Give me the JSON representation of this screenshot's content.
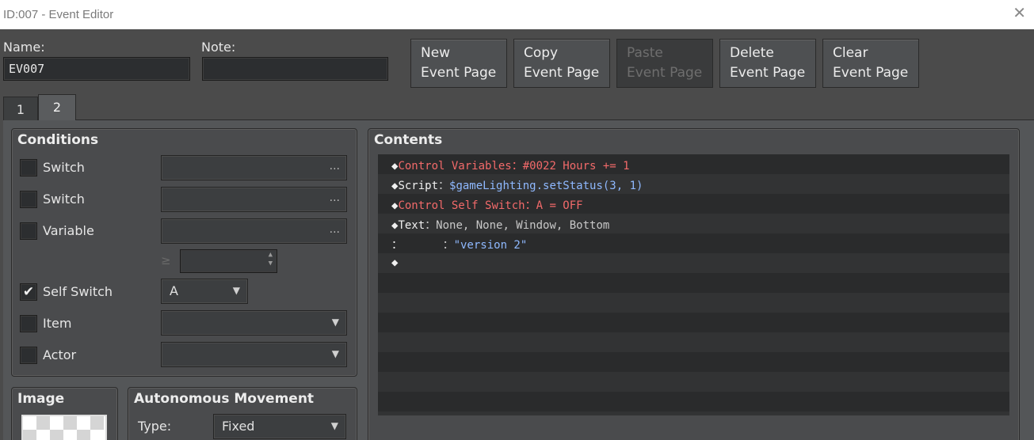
{
  "window": {
    "title": "ID:007 - Event Editor",
    "close_glyph": "✕"
  },
  "name": {
    "label": "Name:",
    "value": "EV007"
  },
  "note": {
    "label": "Note:",
    "value": ""
  },
  "toolbar": {
    "new": [
      "New",
      "Event Page"
    ],
    "copy": [
      "Copy",
      "Event Page"
    ],
    "paste": [
      "Paste",
      "Event Page"
    ],
    "delete": [
      "Delete",
      "Event Page"
    ],
    "clear": [
      "Clear",
      "Event Page"
    ]
  },
  "tabs": [
    "1",
    "2"
  ],
  "active_tab": "2",
  "conditions": {
    "title": "Conditions",
    "switch1": {
      "label": "Switch",
      "checked": false,
      "value": "",
      "dots": "..."
    },
    "switch2": {
      "label": "Switch",
      "checked": false,
      "value": "",
      "dots": "..."
    },
    "variable": {
      "label": "Variable",
      "checked": false,
      "value": "",
      "dots": "..."
    },
    "variable_compare": "≥",
    "variable_value": "",
    "self_switch": {
      "label": "Self Switch",
      "checked": true,
      "checkmark": "✔",
      "value": "A"
    },
    "item": {
      "label": "Item",
      "checked": false,
      "value": ""
    },
    "actor": {
      "label": "Actor",
      "checked": false,
      "value": ""
    }
  },
  "image": {
    "title": "Image"
  },
  "autonomous": {
    "title": "Autonomous Movement",
    "type_label": "Type:",
    "type_value": "Fixed"
  },
  "contents": {
    "title": "Contents",
    "lines": [
      {
        "prefix": "◆",
        "cmd": "Control Variables",
        "sep": "：",
        "args": "#0022 Hours += 1",
        "color": "red"
      },
      {
        "prefix": "◆",
        "cmd": "Script",
        "sep": "：",
        "args": "$gameLighting.setStatus(3, 1)",
        "color": "blue"
      },
      {
        "prefix": "◆",
        "cmd": "Control Self Switch",
        "sep": "：",
        "args": "A = OFF",
        "color": "red"
      },
      {
        "prefix": "◆",
        "cmd": "Text",
        "sep": "：",
        "args": "None, None, Window, Bottom",
        "color": "gray"
      },
      {
        "prefix": "：",
        "cmd": "",
        "sep": "      ：",
        "args": "\"version 2\"",
        "color": "blue"
      },
      {
        "prefix": "◆",
        "cmd": "",
        "sep": "",
        "args": "",
        "color": "white"
      }
    ],
    "empty_rows": 8
  },
  "colors": {
    "red": "#f26a6a",
    "blue": "#8fb9ff",
    "background": "#4b4b4b",
    "list": "#2a2b2c"
  },
  "icons": {
    "close": "close-icon",
    "dots": "ellipsis-icon",
    "dropdown": "chevron-down-icon",
    "spin": "spin-arrows-icon"
  }
}
